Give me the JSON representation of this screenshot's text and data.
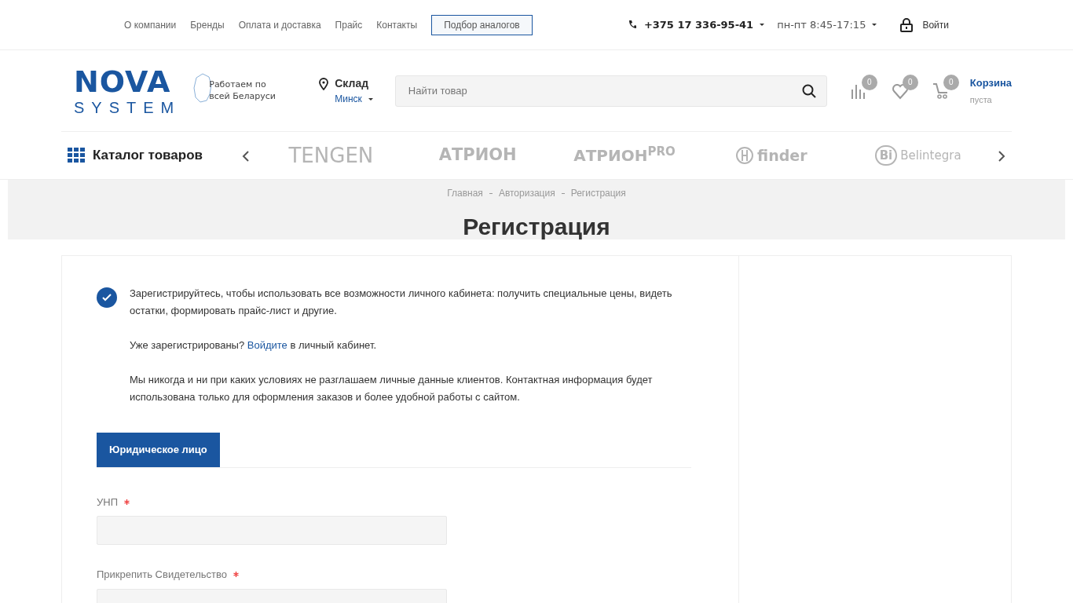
{
  "top_nav": {
    "links": [
      "О компании",
      "Бренды",
      "Оплата и доставка",
      "Прайс",
      "Контакты"
    ],
    "highlight_button": "Подбор аналогов",
    "phone": "+375 17 336-95-41",
    "hours": "пн-пт 8:45-17:15",
    "login": "Войти"
  },
  "header": {
    "logo": {
      "word": "NOVA",
      "sub": "SYSTEM"
    },
    "region_note": "Работаем по всей Беларуси",
    "warehouse": {
      "label": "Склад",
      "city": "Минск"
    },
    "search": {
      "placeholder": "Найти товар"
    },
    "counters": [
      {
        "kind": "compare",
        "count": "0"
      },
      {
        "kind": "favorites",
        "count": "0"
      },
      {
        "kind": "cart",
        "count": "0"
      }
    ],
    "cart": {
      "title": "Корзина",
      "status": "пуста"
    }
  },
  "catalog": {
    "label": "Каталог товаров"
  },
  "brands": [
    {
      "kind": "plain",
      "name": "TENGEN"
    },
    {
      "kind": "bold",
      "name": "АТРИОН"
    },
    {
      "kind": "bold",
      "name": "АТРИОН$^{PRO}$"
    },
    {
      "kind": "finder",
      "name": "finder"
    },
    {
      "kind": "belintegra",
      "mark": "Bi",
      "name": "Belintegra"
    }
  ],
  "breadcrumbs": [
    "Главная",
    "Авторизация",
    "Регистрация"
  ],
  "page_title": "Регистрация",
  "intro": {
    "lead": "Зарегистрируйтесь, чтобы использовать все возможности личного кабинета: получить специальные цены, видеть остатки, формировать прайс-лист и другие.",
    "login_prefix": "Уже зарегистрированы?",
    "login_link": "Войдите",
    "login_suffix": "в личный кабинет.",
    "privacy": "Мы никогда и ни при каких условиях не разглашаем личные данные клиентов. Контактная информация будет использована только для оформления заказов и более удобной работы с сайтом."
  },
  "tabs": [
    {
      "label": "Юридическое лицо",
      "selected": true
    }
  ],
  "fields": [
    {
      "label": "УНП",
      "required": true
    },
    {
      "label": "Прикрепить Свидетельство",
      "required": true
    }
  ]
}
